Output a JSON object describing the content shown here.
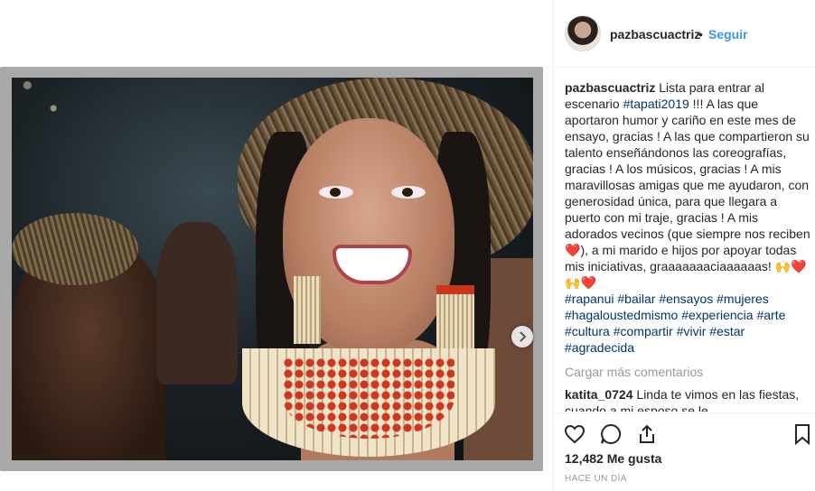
{
  "post": {
    "username": "pazbascuactriz",
    "dot": "•",
    "follow_label": "Seguir"
  },
  "caption": {
    "username": "pazbascuactriz",
    "text_1": " Lista para entrar al escenario ",
    "tag_tapati": "#tapati2019",
    "text_2": " !!! A las que aportaron humor y cariño en este mes de ensayo, gracias ! A las que compartieron su talento enseñándonos las coreografías, gracias ! A los músicos, gracias ! A mis maravillosas amigas que me ayudaron, con generosidad única, para que llegara a puerto con mi traje, gracias ! A mis adorados vecinos (que siempre nos reciben ",
    "heart_1": "❤️",
    "text_3": "), a mi marido e hijos por apoyar todas mis iniciativas, graaaaaaaciaaaaaas! ",
    "emoji_hands": "🙌",
    "heart_2": "❤️",
    "emoji_hands_2": "🙌",
    "heart_3": "❤️",
    "hashtags": [
      "#rapanui",
      "#bailar",
      "#ensayos",
      "#mujeres",
      "#hagaloustedmismo",
      "#experiencia",
      "#arte",
      "#cultura",
      "#compartir",
      "#vivir",
      "#estar",
      "#agradecida"
    ]
  },
  "load_more_label": "Cargar más comentarios",
  "comment": {
    "username": "katita_0724",
    "text": " Linda te vimos en las fiestas, cuando a mi esposo se le"
  },
  "likes_label": "12,482 Me gusta",
  "timestamp": "HACE UN DÍA",
  "icons": {
    "like": "heart-outline-icon",
    "comment": "speech-bubble-icon",
    "share": "share-arrow-icon",
    "save": "bookmark-icon",
    "next": "chevron-right-icon"
  },
  "colors": {
    "link_blue": "#3897f0",
    "hashtag": "#003569",
    "muted": "#999999",
    "text": "#262626"
  }
}
